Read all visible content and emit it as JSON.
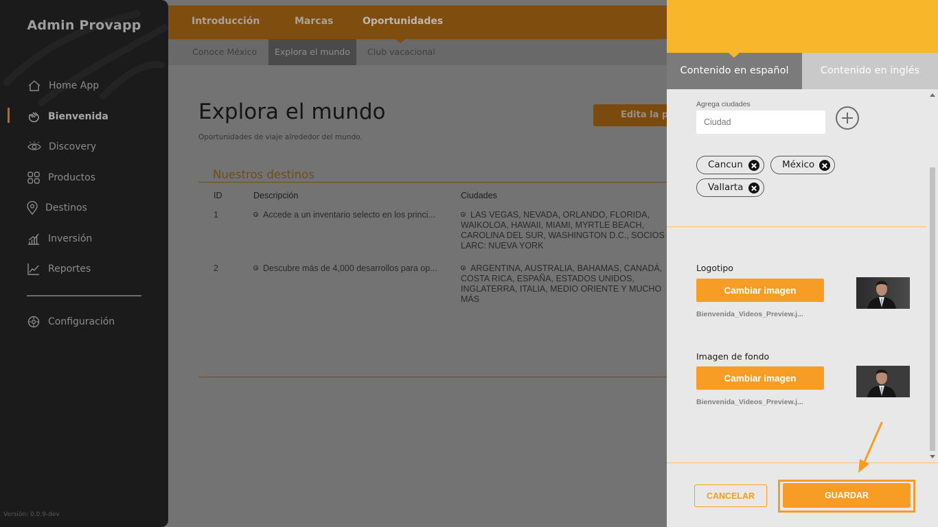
{
  "sidebar": {
    "brand": "Admin Provapp",
    "items": [
      {
        "label": "Home App",
        "icon": "home-icon"
      },
      {
        "label": "Bienvenida",
        "icon": "hand-wave-icon",
        "active": true
      },
      {
        "label": "Discovery",
        "icon": "eye-icon"
      },
      {
        "label": "Productos",
        "icon": "grid-icon"
      },
      {
        "label": "Destinos",
        "icon": "location-pin-icon"
      },
      {
        "label": "Inversión",
        "icon": "bar-chart-icon"
      },
      {
        "label": "Reportes",
        "icon": "line-chart-icon"
      }
    ],
    "settings_label": "Configuración",
    "version": "Versión: 0.0.9-dev"
  },
  "topnav": {
    "tabs": [
      "Introducción",
      "Marcas",
      "Oportunidades"
    ],
    "active_tab": "Oportunidades"
  },
  "subnav": {
    "tabs": [
      "Conoce México",
      "Explora el mundo",
      "Club vacacional"
    ],
    "active_tab": "Explora el mundo"
  },
  "main": {
    "title": "Explora el mundo",
    "subtitle": "Oportunidades de viaje alrededor del mundo.",
    "edit_button": "Edita la po",
    "section_title": "Nuestros destinos",
    "table": {
      "headers": [
        "ID",
        "Descripción",
        "Ciudades"
      ],
      "rows": [
        {
          "id": "1",
          "description": "Accede a un inventario selecto en los princi...",
          "cities": "LAS VEGAS, NEVADA, ORLANDO, FLORIDA, WAIKOLOA, HAWAII, MIAMI, MYRTLE BEACH, CAROLINA DEL SUR, WASHINGTON D.C., SOCIOS LARC: NUEVA YORK"
        },
        {
          "id": "2",
          "description": "Descubre más de 4,000 desarrollos para op...",
          "cities": "ARGENTINA, AUSTRALIA, BAHAMAS, CANADÁ, COSTA RICA, ESPAÑA, ESTADOS UNIDOS, INGLATERRA, ITALIA, MEDIO ORIENTE Y MUCHO MÁS"
        }
      ]
    }
  },
  "drawer": {
    "tabs": [
      "Contenido en español",
      "Contenido en inglés"
    ],
    "active_tab": "Contenido en español",
    "add_cities_label": "Agrega ciudades",
    "city_input": {
      "placeholder": "Ciudad",
      "value": ""
    },
    "chips": [
      "Cancun",
      "México",
      "Vallarta"
    ],
    "logo": {
      "label": "Logotipo",
      "button": "Cambiar imagen",
      "filename": "Bienvenida_Videos_Preview.j..."
    },
    "background": {
      "label": "Imagen de fondo",
      "button": "Cambiar imagen",
      "filename": "Bienvenida_Videos_Preview.j..."
    },
    "cancel": "CANCELAR",
    "save": "GUARDAR"
  },
  "colors": {
    "accent": "#f79c25",
    "header_yellow": "#f8b62b",
    "sidebar_bg": "#1b1b1b",
    "overlay_gray": "#737373"
  }
}
